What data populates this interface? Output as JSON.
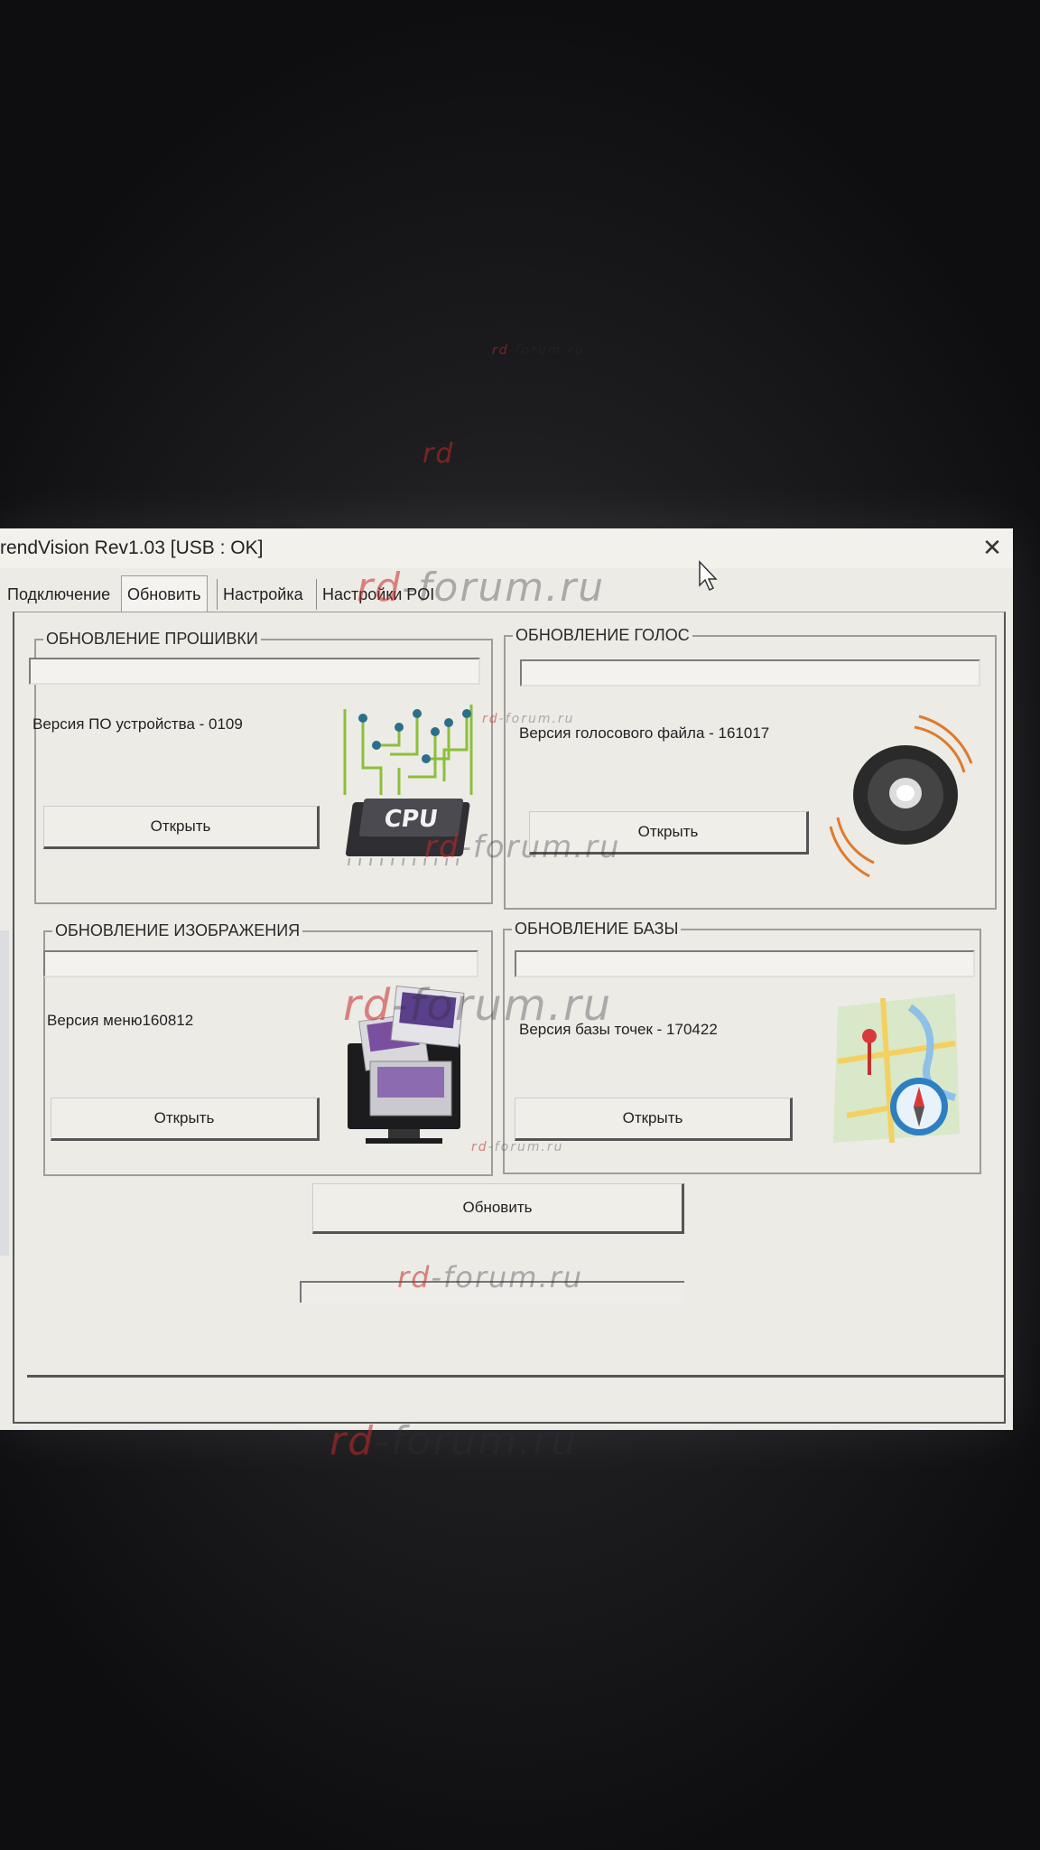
{
  "window": {
    "title": "rendVision Rev1.03 [USB : OK]",
    "close_glyph": "✕"
  },
  "tabs": [
    {
      "label": "Подключение"
    },
    {
      "label": "Обновить"
    },
    {
      "label": "Настройка"
    },
    {
      "label": "Настройки POI"
    }
  ],
  "active_tab": "Обновить",
  "firmware": {
    "title": "ОБНОВЛЕНИЕ ПРОШИВКИ",
    "version_text": "Версия ПО устройства - 0109",
    "open_label": "Открыть",
    "icon": "cpu-icon",
    "icon_text": "CPU"
  },
  "voice": {
    "title": "ОБНОВЛЕНИЕ ГОЛОС",
    "version_text": "Версия голосового файла - 161017",
    "open_label": "Открыть",
    "icon": "speaker-icon"
  },
  "images": {
    "title": "ОБНОВЛЕНИЕ ИЗОБРАЖЕНИЯ",
    "version_text": "Версия меню160812",
    "open_label": "Открыть",
    "icon": "images-monitor-icon"
  },
  "database": {
    "title": "ОБНОВЛЕНИЕ БАЗЫ",
    "version_text": "Версия базы точек - 170422",
    "open_label": "Открыть",
    "icon": "map-compass-icon"
  },
  "update_label": "Обновить",
  "watermark": {
    "prefix": "rd",
    "suffix": "-forum.ru"
  },
  "colors": {
    "window_bg": "#ecebe6",
    "watermark_red": "#c82828"
  }
}
